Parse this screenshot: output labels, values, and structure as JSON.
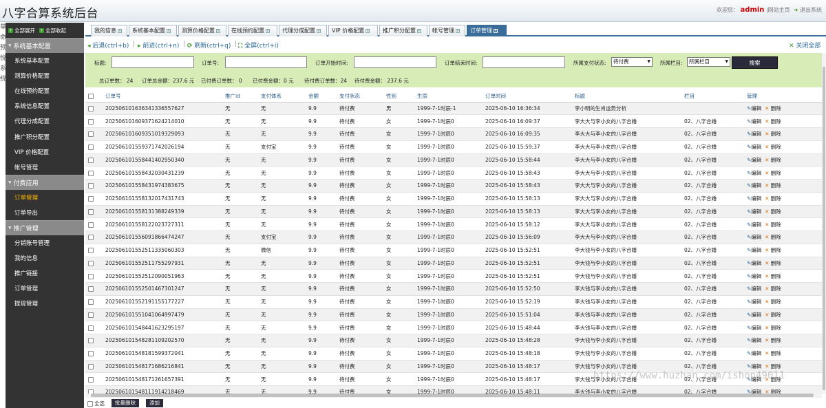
{
  "header": {
    "title": "八字合算系统后台",
    "welcome": "欢迎您：",
    "user": "admin",
    "home_link": "|网站主页",
    "exit": "退出系统"
  },
  "left_strip": [
    "草",
    "命",
    "预",
    "悦",
    "系",
    "统"
  ],
  "sidebar": {
    "expand_all": "全部展开",
    "collapse_all": "全部收起",
    "sections": [
      {
        "label": "系统基本配置",
        "items": [
          "系统基本配置",
          "测算价格配置",
          "在线预约配置",
          "系统信息配置",
          "代理分成配置",
          "推广积分配置",
          "VIP 价格配置",
          "帐号管理"
        ]
      },
      {
        "label": "付费应用",
        "items": [
          "订单管理",
          "订单导出"
        ]
      },
      {
        "label": "推广管理",
        "items": [
          "分销账号管理",
          "我的信息",
          "推广链接",
          "订单管理",
          "提现管理"
        ]
      }
    ],
    "active_item": "订单管理"
  },
  "tabs": [
    "我的信息",
    "系统基本配置",
    "测算价格配置",
    "在线预约配置",
    "代理分成配置",
    "VIP 价格配置",
    "推广积分配置",
    "帐号管理",
    "订单管理"
  ],
  "active_tab": "订单管理",
  "toolbar": {
    "back": "后退(ctrl+b)",
    "forward": "前进(ctrl+n)",
    "refresh": "刷新(ctrl+q)",
    "fullscreen": "全屏(ctrl+i)",
    "close_all": "关闭全部"
  },
  "filter": {
    "title_label": "标题:",
    "order_no_label": "订单号:",
    "start_time_label": "订单开始时间:",
    "end_time_label": "订单结束时间:",
    "pay_status_label": "所属支付状态:",
    "pay_status_value": "待付费",
    "column_label": "所属栏目:",
    "column_value": "所属栏目",
    "search_button": "搜索"
  },
  "stats": {
    "total_orders": "总订单数： 24",
    "total_amount": "订单总金额：237.6 元",
    "paid_orders": "已付费订单数： 0",
    "paid_amount": "已付费金额：0 元",
    "pending_orders": "待付费订单数：24",
    "pending_amount": "待付费金额： 237.6 元"
  },
  "table": {
    "headers": [
      "订单号",
      "推广id",
      "支付体系",
      "金额",
      "支付状态",
      "性别",
      "生辰",
      "订单时间",
      "标题",
      "栏目",
      "管理"
    ],
    "edit_label": "编辑",
    "delete_label": "删除",
    "rows": [
      [
        "202506101636341336557627",
        "无",
        "无",
        "9.9",
        "待付费",
        "男",
        "1999-7-1时辰-1",
        "2025-06-10 16:36:34",
        "李小明的生肖运势分析",
        ""
      ],
      [
        "202506101609371624214010",
        "无",
        "无",
        "9.9",
        "待付费",
        "女",
        "1999-7-1时辰0",
        "2025-06-10 16:09:37",
        "李大大与李小女的八字合婚",
        "02、八字合婚"
      ],
      [
        "202506101609351019329093",
        "无",
        "无",
        "9.9",
        "待付费",
        "女",
        "1999-7-1时辰0",
        "2025-06-10 16:09:35",
        "李大大与李小女的八字合婚",
        "02、八字合婚"
      ],
      [
        "202506101559371742026194",
        "无",
        "支付宝",
        "9.9",
        "待付费",
        "女",
        "1999-7-1时辰0",
        "2025-06-10 15:59:37",
        "李大大与李小女的八字合婚",
        "02、八字合婚"
      ],
      [
        "202506101558441402950340",
        "无",
        "无",
        "9.9",
        "待付费",
        "女",
        "1999-7-1时辰0",
        "2025-06-10 15:58:44",
        "李大大与李小女的八字合婚",
        "02、八字合婚"
      ],
      [
        "202506101558432030431239",
        "无",
        "无",
        "9.9",
        "待付费",
        "女",
        "1999-7-1时辰0",
        "2025-06-10 15:58:43",
        "李大大与李小女的八字合婚",
        "02、八字合婚"
      ],
      [
        "202506101558431974383675",
        "无",
        "无",
        "9.9",
        "待付费",
        "女",
        "1999-7-1时辰0",
        "2025-06-10 15:58:43",
        "李大大与李小女的八字合婚",
        "02、八字合婚"
      ],
      [
        "202506101558132017431743",
        "无",
        "无",
        "9.9",
        "待付费",
        "女",
        "1999-7-1时辰0",
        "2025-06-10 15:58:13",
        "李大大与李小女的八字合婚",
        "02、八字合婚"
      ],
      [
        "202506101558131388249339",
        "无",
        "无",
        "9.9",
        "待付费",
        "女",
        "1999-7-1时辰0",
        "2025-06-10 15:58:13",
        "李大大与李小女的八字合婚",
        "02、八字合婚"
      ],
      [
        "202506101558122023727311",
        "无",
        "无",
        "9.9",
        "待付费",
        "女",
        "1999-7-1时辰0",
        "2025-06-10 15:58:12",
        "李大大与李小女的八字合婚",
        "02、八字合婚"
      ],
      [
        "202506101556091866474247",
        "无",
        "支付宝",
        "9.9",
        "待付费",
        "女",
        "1999-7-1时辰0",
        "2025-06-10 15:56:09",
        "李大大与李小女的八字合婚",
        "02、八字合婚"
      ],
      [
        "202506101552511335060303",
        "无",
        "微信",
        "9.9",
        "待付费",
        "女",
        "1999-7-1时辰0",
        "2025-06-10 15:52:51",
        "李大钱与李小女的八字合婚",
        "02、八字合婚"
      ],
      [
        "202506101552511755297931",
        "无",
        "无",
        "9.9",
        "待付费",
        "女",
        "1999-7-1时辰0",
        "2025-06-10 15:52:51",
        "李大钱与李小女的八字合婚",
        "02、八字合婚"
      ],
      [
        "202506101552512090051963",
        "无",
        "无",
        "9.9",
        "待付费",
        "女",
        "1999-7-1时辰0",
        "2025-06-10 15:52:51",
        "李大钱与李小女的八字合婚",
        "02、八字合婚"
      ],
      [
        "202506101552501467301247",
        "无",
        "无",
        "9.9",
        "待付费",
        "女",
        "1999-7-1时辰0",
        "2025-06-10 15:52:50",
        "李大钱与李小女的八字合婚",
        "02、八字合婚"
      ],
      [
        "202506101552191155177227",
        "无",
        "无",
        "9.9",
        "待付费",
        "女",
        "1999-7-1时辰0",
        "2025-06-10 15:52:19",
        "李大钱与李小女的八字合婚",
        "02、八字合婚"
      ],
      [
        "202506101551041064997479",
        "无",
        "无",
        "9.9",
        "待付费",
        "女",
        "1999-7-1时辰0",
        "2025-06-10 15:51:04",
        "李大钱与李小女的八字合婚",
        "02、八字合婚"
      ],
      [
        "202506101548441623295197",
        "无",
        "无",
        "9.9",
        "待付费",
        "女",
        "1999-7-1时辰0",
        "2025-06-10 15:48:44",
        "李大钱与李小女的八字合婚",
        "02、八字合婚"
      ],
      [
        "202506101548281109202570",
        "无",
        "无",
        "9.9",
        "待付费",
        "女",
        "1999-7-1时辰0",
        "2025-06-10 15:48:28",
        "李大钱与李小女的八字合婚",
        "02、八字合婚"
      ],
      [
        "202506101548181599372041",
        "无",
        "无",
        "9.9",
        "待付费",
        "女",
        "1999-7-1时辰0",
        "2025-06-10 15:48:18",
        "李大钱与李小女的八字合婚",
        "02、八字合婚"
      ],
      [
        "202506101548171686216841",
        "无",
        "无",
        "9.9",
        "待付费",
        "女",
        "1999-7-1时辰0",
        "2025-06-10 15:48:17",
        "李大钱与李小女的八字合婚",
        "02、八字合婚"
      ],
      [
        "202506101548171261657391",
        "无",
        "无",
        "9.9",
        "待付费",
        "女",
        "1999-7-1时辰0",
        "2025-06-10 15:48:17",
        "李大钱与李小女的八字合婚",
        "02、八字合婚"
      ],
      [
        "202506101548111914218469",
        "无",
        "无",
        "9.9",
        "待付费",
        "女",
        "1999-7-1时辰0",
        "2025-06-10 15:48:11",
        "李大钱与李小女的八字合婚",
        "02、八字合婚"
      ]
    ]
  },
  "footer": {
    "select_all": "全选",
    "batch_delete": "批量删除",
    "add": "添加"
  },
  "watermark": "https://www.huzhan.com/ishop49011"
}
